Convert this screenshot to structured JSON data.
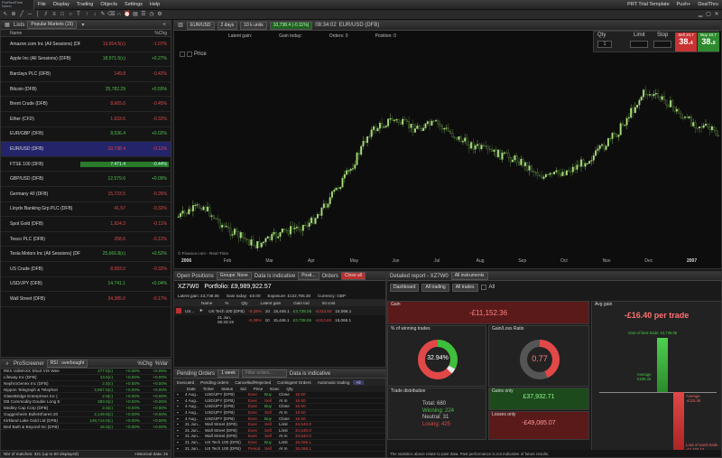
{
  "app": {
    "logo_lines": [
      "ProRealTime",
      "Demo"
    ]
  },
  "menu": [
    "File",
    "Display",
    "Trading",
    "Objects",
    "Settings",
    "Help"
  ],
  "topright": [
    "PRT Trial Template",
    "Push+",
    "DealThru"
  ],
  "lists": {
    "tab": "Lists",
    "list_name": "Popular Markets (15)",
    "col_name": "Name",
    "col_pct": "%Chg",
    "rows": [
      {
        "name": "Amazon.com Inc (All Sessions) (DFB)",
        "price": "13,654.5(c)",
        "pct": "-1.07%",
        "dir": "down"
      },
      {
        "name": "Apple Inc (All Sessions) (DFB)",
        "price": "18,971.5(c)",
        "pct": "+0.27%",
        "dir": "up"
      },
      {
        "name": "Barclays PLC (DFB)",
        "price": "149.8",
        "pct": "-0.42%",
        "dir": "down"
      },
      {
        "name": "Bitcoin (DFB)",
        "price": "25,782.29",
        "pct": "+0.55%",
        "dir": "up"
      },
      {
        "name": "Brent Crude (DFB)",
        "price": "8,665.0",
        "pct": "-0.45%",
        "dir": "down"
      },
      {
        "name": "Ether (CFD)",
        "price": "1,633.6",
        "pct": "-0.32%",
        "dir": "down"
      },
      {
        "name": "EUR/GBP (DFB)",
        "price": "8,536.4",
        "pct": "+0.02%",
        "dir": "up"
      },
      {
        "name": "EUR/USD (DFB)",
        "price": "10,738.4",
        "pct": "-0.11%",
        "dir": "down"
      },
      {
        "name": "FTSE 100 (DFB)",
        "price": "7,471.4",
        "pct": "-0.44%",
        "dir": "down"
      },
      {
        "name": "GBP/USD (DFB)",
        "price": "12,579.6",
        "pct": "+0.09%",
        "dir": "up"
      },
      {
        "name": "Germany 40 (DFB)",
        "price": "15,723.5",
        "pct": "-0.26%",
        "dir": "down"
      },
      {
        "name": "Lloyds Banking Grp PLC (DFB)",
        "price": "41.57",
        "pct": "-0.32%",
        "dir": "down"
      },
      {
        "name": "Spot Gold (DFB)",
        "price": "1,924.3",
        "pct": "-0.11%",
        "dir": "down"
      },
      {
        "name": "Tesco PLC (DFB)",
        "price": "258.6",
        "pct": "-0.12%",
        "dir": "down"
      },
      {
        "name": "Tesla Motors Inc (All Sessions) (DFB)",
        "price": "25,666.8(c)",
        "pct": "+0.52%",
        "dir": "up"
      },
      {
        "name": "US Crude (DFB)",
        "price": "8,583.0",
        "pct": "-0.32%",
        "dir": "down"
      },
      {
        "name": "USD/JPY (DFB)",
        "price": "14,741.1",
        "pct": "+0.04%",
        "dir": "up"
      },
      {
        "name": "Wall Street (DFB)",
        "price": "34,385.0",
        "pct": "-0.17%",
        "dir": "down"
      }
    ]
  },
  "screener": {
    "title": "ProScreener",
    "name": "RSI : overbought",
    "col_pct": "%Chg",
    "col_var": "%Var",
    "rows": [
      {
        "name": "REX VolMAXX Short VIX Wee",
        "price": "277.5(c)",
        "pct": "+0.00%",
        "var": "+0.05%"
      },
      {
        "name": "Lifeway Inc (DFB)",
        "price": "13.5(c)",
        "pct": "+0.00%",
        "var": "+0.00%"
      },
      {
        "name": "NephroGenex Inc (DFB)",
        "price": "2.5(c)",
        "pct": "+0.00%",
        "var": "+0.00%"
      },
      {
        "name": "Nippon Telegraph & Telephon",
        "price": "2,867.5(c)",
        "pct": "+0.00%",
        "var": "+0.00%"
      },
      {
        "name": "GlassBridge Enterprises Inc (",
        "price": "2.9(c)",
        "pct": "+0.00%",
        "var": "+0.00%"
      },
      {
        "name": "DB Commodity Double Long E",
        "price": "383.0(c)",
        "pct": "+0.00%",
        "var": "+0.00%"
      },
      {
        "name": "Medley Cap Corp (DFB)",
        "price": "2.5(c)",
        "pct": "+0.00%",
        "var": "+0.00%"
      },
      {
        "name": "Guggenheim BulletShares 20",
        "price": "2,149.8(c)",
        "pct": "+0.00%",
        "var": "+0.00%"
      },
      {
        "name": "Kirkland Lake Gold Ltd (DFB)",
        "price": "149,714.8(c)",
        "pct": "+0.00%",
        "var": "+0.00%"
      },
      {
        "name": "Bed Bath & Beyond Inc (DFB)",
        "price": "16.5(c)",
        "pct": "+0.00%",
        "var": "+0.00%"
      }
    ],
    "footer": "Nbr of matches: 321 (up to 50 displayed)",
    "footer2": "Historical data: 2s"
  },
  "chart": {
    "instrument": "EUR/USD",
    "timeframe": "2 days",
    "units": "10 k units",
    "price_badge": "10,738.4 (-0.11%)",
    "time": "08:34:02",
    "product": "EUR/USD (DFB)",
    "latent_gain": "Latent gain:",
    "gain_today": "Gain today:",
    "orders": "Orders:",
    "position": "Position:",
    "zero": "0",
    "qty_label": "Qty",
    "qty_value": "1",
    "limit_label": "Limit",
    "stop_label": "Stop",
    "sell_label": "Sell",
    "buy_label": "Buy",
    "sell_price": "38.",
    "buy_price": "38.",
    "sell_sup": "10,7",
    "buy_sup": "10,7",
    "sell_end": "4",
    "buy_end": "8",
    "price_label": "Price",
    "source": "© Finance.com - Real-Time",
    "xlabels": [
      "2006",
      "Feb",
      "Mar",
      "Apr",
      "May",
      "Jun",
      "Jul",
      "Aug",
      "Sep",
      "Oct",
      "Nov",
      "Dec",
      "2007"
    ]
  },
  "positions": {
    "tab": "Open Positions",
    "groups": "Groups: None",
    "indicative": "Data is indicative",
    "search": "Posit...",
    "orders": "Orders",
    "close": "Close all",
    "account": "XZ7W0",
    "portfolio": "Portfolio: £9,989,922.57",
    "latent": "Latent gain: £3,738.06",
    "gain_today": "Gain today: -£0.00",
    "exposure": "Exposure: £122,765.30",
    "currency": "Currency: GBP",
    "cols": [
      "Name",
      "%",
      "Qty",
      "Latent gain",
      "Gain tod",
      "Int cost"
    ],
    "group_row": [
      "US...",
      "US Tech 100 (DFB)",
      "-0.28%",
      "10",
      "15,446.1",
      "£3,738.06",
      "-£313.60",
      "15,066.1"
    ],
    "sub_row": [
      "21 Jun, 06:33:19",
      "-0.28%",
      "10",
      "15,446.1",
      "£3,738.06",
      "-£313.60",
      "15,066.1"
    ]
  },
  "orders": {
    "tab": "Pending Orders",
    "period": "1 week",
    "filter": "Filter orders...",
    "indicative": "Data is indicative",
    "tabs": [
      "Executed",
      "Pending orders",
      "Cancelled/Rejected",
      "Contingent Orders",
      "Automatic trading",
      "All"
    ],
    "cols": [
      "Date",
      "Ticker",
      "Status",
      "Sid",
      "Price",
      "Exec",
      "Qty"
    ],
    "rows": [
      [
        "4 Aug...",
        "USD/JPY (DFB)",
        "Exec",
        "Buy",
        "Close",
        "16.50"
      ],
      [
        "4 Aug...",
        "USD/JPY (DFB)",
        "Exec",
        "Sell",
        "At m",
        "16.50"
      ],
      [
        "4 Aug...",
        "USD/JPY (DFB)",
        "Exec",
        "Buy",
        "Close",
        "16.50"
      ],
      [
        "4 Aug...",
        "USD/JPY (DFB)",
        "Exec",
        "Sell",
        "At m",
        "16.50"
      ],
      [
        "4 Aug...",
        "USD/JPY (DFB)",
        "Exec",
        "Buy",
        "Close",
        "16.50"
      ],
      [
        "21 Jun...",
        "Wall Street (DFB)",
        "Exec",
        "Sell",
        "Limit",
        "34,540.0"
      ],
      [
        "21 Jun...",
        "Wall Street (DFB)",
        "Exec",
        "Sell",
        "Limit",
        "34,540.0"
      ],
      [
        "21 Jun...",
        "Wall Street (DFB)",
        "Exec",
        "Sell",
        "At m",
        "34,540.0"
      ],
      [
        "21 Jun...",
        "US Tech 100 (DFB)",
        "Exec",
        "Buy",
        "Limit",
        "15,066.1"
      ],
      [
        "21 Jun...",
        "US Tech 100 (DFB)",
        "Period",
        "Sell",
        "At m",
        "15,066.1"
      ]
    ]
  },
  "report": {
    "tab": "Detailed report - XZ7W0",
    "instruments": "All instruments",
    "dashboard": "Dashboard",
    "trading": "All trading",
    "trades": "All trades",
    "all": "All",
    "gain_label": "Gain",
    "gain_value": "-£11,152.36",
    "avg_label": "Avg gain",
    "avg_value": "-£16.40 per trade",
    "winning_label": "% of winning trades",
    "winning_value": "32.94%",
    "winning_frac": 0.3294,
    "ratio_label": "Gain/Loss Ratio",
    "ratio_value": "0.77",
    "ratio_frac": 0.435,
    "dist_label": "Trade distribution",
    "total": "Total: 680",
    "winning": "Winning: 224",
    "neutral": "Neutral: 31",
    "losing": "Losing: 425",
    "gains_only": "Gains only",
    "gains_value": "£37,932.71",
    "losses_only": "Losses only",
    "losses_value": "-£49,085.07",
    "bar_top": "Gain of best trade: £3,738.06",
    "bar_avg": "Average",
    "bar_avg_v": "£169.34",
    "bar_loss": "Average",
    "bar_loss_v": "-£115.46",
    "bar_low": "Loss of worst trade",
    "bar_low_v": "-£2,150.10",
    "footer": "The statistics above relate to past data. Past performance is not indicative of future results.",
    "colors": {
      "win": "#3cc03c",
      "loss": "#e14848",
      "neutral": "#e8e8e8"
    }
  }
}
